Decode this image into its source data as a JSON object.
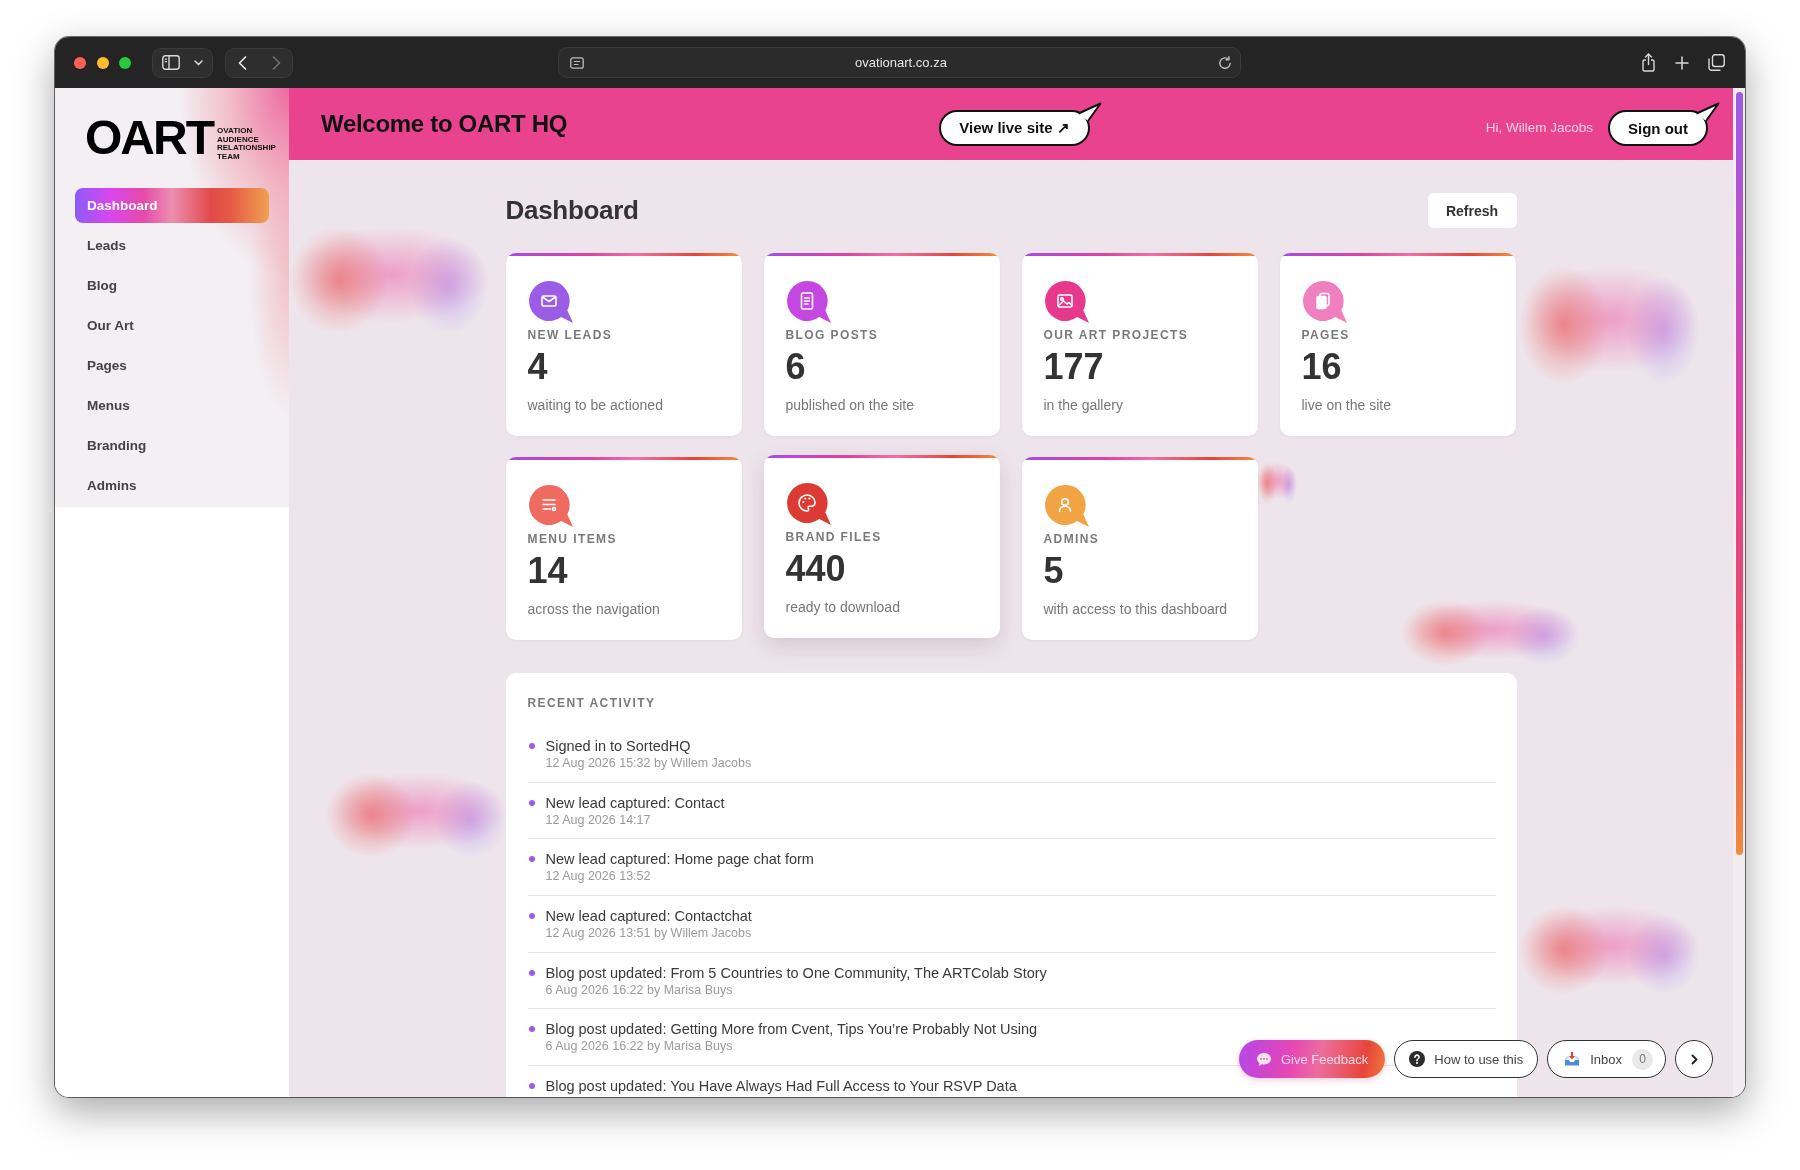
{
  "browser": {
    "url": "ovationart.co.za",
    "back_disabled": false,
    "forward_disabled": true
  },
  "sidebar": {
    "logo": {
      "wordmark": "OART",
      "tagline": "OVATION AUDIENCE RELATIONSHIP TEAM"
    },
    "items": [
      {
        "label": "Dashboard",
        "selected": true
      },
      {
        "label": "Leads",
        "selected": false
      },
      {
        "label": "Blog",
        "selected": false
      },
      {
        "label": "Our Art",
        "selected": false
      },
      {
        "label": "Pages",
        "selected": false
      },
      {
        "label": "Menus",
        "selected": false
      },
      {
        "label": "Branding",
        "selected": false
      },
      {
        "label": "Admins",
        "selected": false
      }
    ]
  },
  "header": {
    "title": "Welcome to OART HQ",
    "live_site_button": "View live site ↗",
    "greeting": "Hi, Willem Jacobs",
    "sign_out_button": "Sign out"
  },
  "page": {
    "title": "Dashboard",
    "refresh_button": "Refresh"
  },
  "stats": [
    {
      "label": "NEW LEADS",
      "value": "4",
      "caption": "waiting to be actioned",
      "color": "#9b5ce6",
      "hovered": false
    },
    {
      "label": "BLOG POSTS",
      "value": "6",
      "caption": "published on the site",
      "color": "#c347e0",
      "hovered": false
    },
    {
      "label": "OUR ART PROJECTS",
      "value": "177",
      "caption": "in the gallery",
      "color": "#e6388c",
      "hovered": false
    },
    {
      "label": "PAGES",
      "value": "16",
      "caption": "live on the site",
      "color": "#ef7fbf",
      "hovered": false
    },
    {
      "label": "MENU ITEMS",
      "value": "14",
      "caption": "across the navigation",
      "color": "#ef6a5f",
      "hovered": false
    },
    {
      "label": "BRAND FILES",
      "value": "440",
      "caption": "ready to download",
      "color": "#dc3b33",
      "hovered": true
    },
    {
      "label": "ADMINS",
      "value": "5",
      "caption": "with access to this dashboard",
      "color": "#f2a445",
      "hovered": false
    }
  ],
  "recent_activity": {
    "title": "RECENT ACTIVITY",
    "items": [
      {
        "title": "Signed in to SortedHQ",
        "meta": "12 Aug 2026 15:32 by Willem Jacobs"
      },
      {
        "title": "New lead captured: Contact",
        "meta": "12 Aug 2026 14:17"
      },
      {
        "title": "New lead captured: Home page chat form",
        "meta": "12 Aug 2026 13:52"
      },
      {
        "title": "New lead captured: Contactchat",
        "meta": "12 Aug 2026 13:51 by Willem Jacobs"
      },
      {
        "title": "Blog post updated: From 5 Countries to One Community, The ARTColab Story",
        "meta": "6 Aug 2026 16:22 by Marisa Buys"
      },
      {
        "title": "Blog post updated: Getting More from Cvent, Tips You’re Probably Not Using",
        "meta": "6 Aug 2026 16:22 by Marisa Buys"
      },
      {
        "title": "Blog post updated: You Have Always Had Full Access to Your RSVP Data"
      }
    ]
  },
  "help_bar": {
    "feedback_button": "Give Feedback",
    "help_button": "How to use this",
    "inbox_button": "Inbox",
    "inbox_count": "0"
  }
}
